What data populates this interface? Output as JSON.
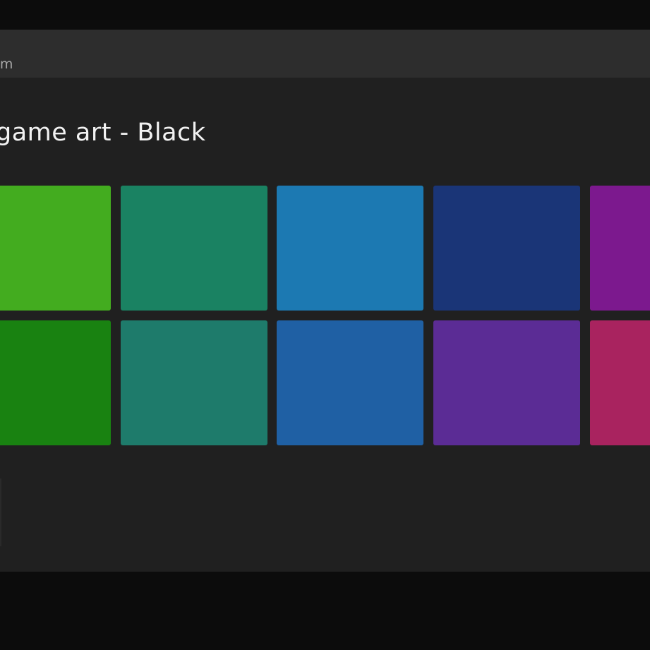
{
  "address_bar": {
    "partial_text": "om"
  },
  "page": {
    "title": "game art - Black"
  },
  "color_tiles": [
    {
      "name": "tile-green-light",
      "color": "#43ac1f"
    },
    {
      "name": "tile-teal-dark",
      "color": "#1a8262"
    },
    {
      "name": "tile-blue-light",
      "color": "#1c79b2"
    },
    {
      "name": "tile-navy",
      "color": "#1a3577"
    },
    {
      "name": "tile-purple-magenta",
      "color": "#7c198e"
    },
    {
      "name": "tile-green-dark",
      "color": "#198211"
    },
    {
      "name": "tile-teal",
      "color": "#1e7b6b"
    },
    {
      "name": "tile-blue",
      "color": "#1f60a4"
    },
    {
      "name": "tile-purple",
      "color": "#5b2c95"
    },
    {
      "name": "tile-crimson",
      "color": "#a9235f"
    }
  ]
}
